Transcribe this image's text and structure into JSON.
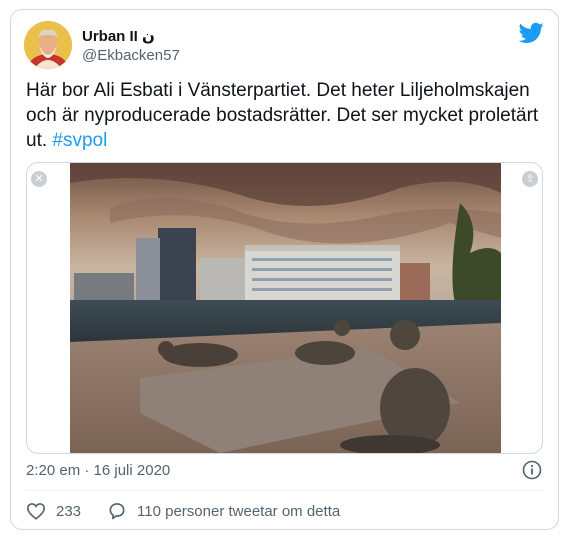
{
  "tweet": {
    "author_name": "Urban II ن",
    "author_handle": "@Ekbacken57",
    "text": "Här bor Ali Esbati i Vänsterpartiet. Det heter Liljeholmskajen och är nyproducerade bostadsrätter. Det ser mycket proletärt ut. ",
    "hashtag": "#svpol",
    "timestamp": "2:20 em · 16 juli 2020",
    "likes": "233",
    "retweet_text": "110 personer tweetar om detta"
  },
  "icons": {
    "platform": "twitter-bird-icon",
    "like": "heart-icon",
    "reply": "speech-bubble-icon",
    "info": "info-icon",
    "media_close": "close-icon",
    "media_share": "share-icon"
  },
  "colors": {
    "accent": "#1d9bf0",
    "secondary_text": "#536471",
    "border": "#cfd9de"
  }
}
